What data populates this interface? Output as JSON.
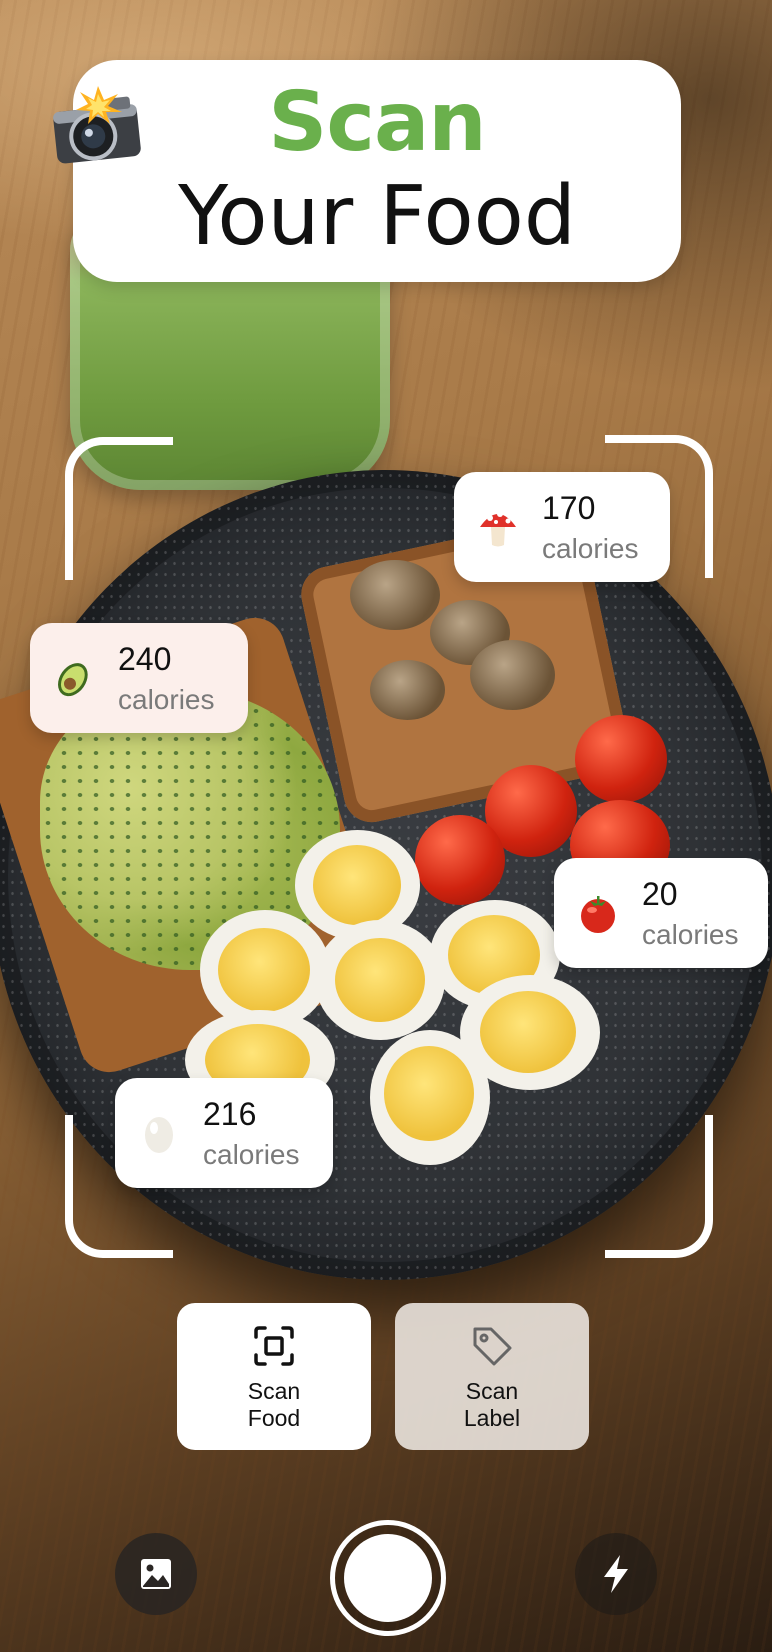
{
  "header": {
    "title_accent": "Scan",
    "title_main": "Your Food",
    "title_accent_color": "#6ab04c",
    "icon": "camera-flash-icon"
  },
  "detections": [
    {
      "item": "mushroom",
      "icon": "mushroom-icon",
      "calories": "170",
      "unit": "calories"
    },
    {
      "item": "avocado",
      "icon": "avocado-icon",
      "calories": "240",
      "unit": "calories"
    },
    {
      "item": "tomato",
      "icon": "tomato-icon",
      "calories": "20",
      "unit": "calories"
    },
    {
      "item": "egg",
      "icon": "egg-icon",
      "calories": "216",
      "unit": "calories"
    }
  ],
  "modes": [
    {
      "label": "Scan\nFood",
      "icon": "scan-frame-icon",
      "selected": true
    },
    {
      "label": "Scan\nLabel",
      "icon": "tag-icon",
      "selected": false
    }
  ],
  "controls": {
    "gallery_icon": "gallery-icon",
    "shutter": "shutter-button",
    "flash_icon": "flash-icon"
  }
}
